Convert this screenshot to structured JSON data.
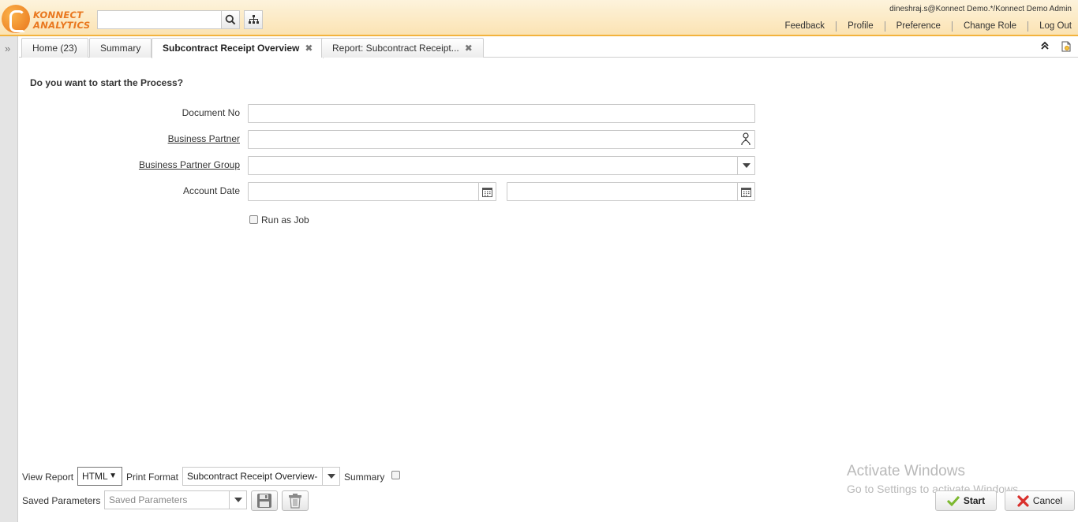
{
  "header": {
    "logo_line1": "KONNECT",
    "logo_line2": "ANALYTICS",
    "search_placeholder": "",
    "user_info": "dineshraj.s@Konnect Demo.*/Konnect Demo Admin",
    "links": [
      "Feedback",
      "Profile",
      "Preference",
      "Change Role",
      "Log Out"
    ]
  },
  "tabs": [
    {
      "label": "Home (23)",
      "active": false,
      "closable": false
    },
    {
      "label": "Summary",
      "active": false,
      "closable": false
    },
    {
      "label": "Subcontract Receipt Overview",
      "active": true,
      "closable": true
    },
    {
      "label": "Report: Subcontract Receipt...",
      "active": false,
      "closable": true
    }
  ],
  "form": {
    "question": "Do you want to start the Process?",
    "document_no_label": "Document No",
    "document_no_value": "",
    "business_partner_label": "Business Partner",
    "business_partner_value": "",
    "bp_group_label": "Business Partner Group",
    "bp_group_value": "",
    "account_date_label": "Account Date",
    "account_date_from": "",
    "account_date_to": "",
    "run_as_job_label": "Run as Job",
    "run_as_job_checked": false
  },
  "bottom": {
    "view_report_label": "View Report",
    "view_report_value": "HTML",
    "print_format_label": "Print Format",
    "print_format_value": "Subcontract Receipt Overview-",
    "summary_label": "Summary",
    "summary_checked": false,
    "saved_params_label": "Saved Parameters",
    "saved_params_placeholder": "Saved Parameters",
    "start_label": "Start",
    "cancel_label": "Cancel"
  },
  "watermark": {
    "line1": "Activate Windows",
    "line2": "Go to Settings to activate Windows."
  },
  "colors": {
    "header_border": "#f3b33d",
    "logo_orange": "#e9781f",
    "start_check": "#7cb82f",
    "cancel_x": "#d9302c"
  }
}
